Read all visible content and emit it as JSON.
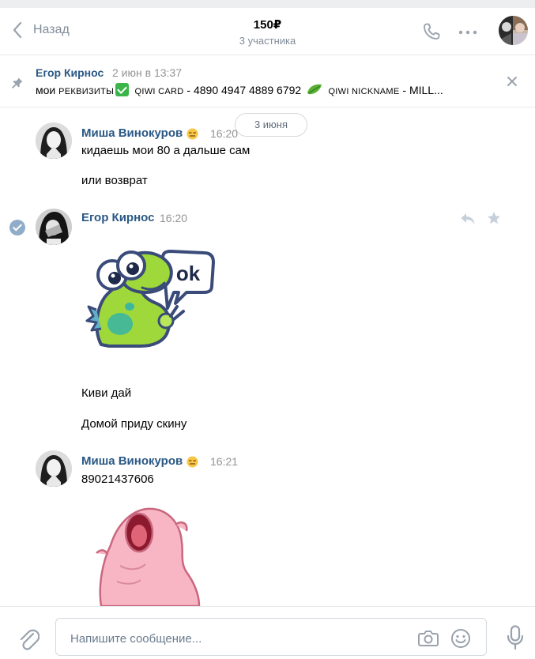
{
  "header": {
    "back_label": "Назад",
    "title": "150₽",
    "subtitle": "3 участника"
  },
  "pinned": {
    "author": "Егор Кирнос",
    "date": "2 июн в 13:37",
    "text_1": "мои ",
    "text_2": "РЕКВИЗИТЫ",
    "text_3": " QIWI CARD",
    "text_4": " - 4890 4947 4889 6792 ",
    "text_5": " QIWI NICKNAME",
    "text_6": " - MILL..."
  },
  "date_separator": "3 июня",
  "messages": [
    {
      "author": "Миша Винокуров",
      "time": "16:20",
      "lines": [
        "кидаешь мои 80 а дальше сам",
        "или возврат"
      ]
    },
    {
      "author": "Егор Кирнос",
      "time": "16:20",
      "sticker_text": "ok",
      "lines": [
        "Киви дай",
        "Домой приду скину"
      ]
    },
    {
      "author": "Миша Винокуров",
      "time": "16:21",
      "lines": [
        "89021437606"
      ]
    }
  ],
  "composer": {
    "placeholder": "Напишите сообщение..."
  },
  "colors": {
    "link_name": "#2a5885",
    "muted": "#818c99",
    "border": "#e7e8ec",
    "check_green": "#3bb54a"
  },
  "icons": [
    "chevron-left-icon",
    "phone-icon",
    "more-icon",
    "pin-icon",
    "close-icon",
    "check-icon",
    "reply-icon",
    "star-icon",
    "attach-icon",
    "camera-icon",
    "smile-icon",
    "mic-icon"
  ]
}
